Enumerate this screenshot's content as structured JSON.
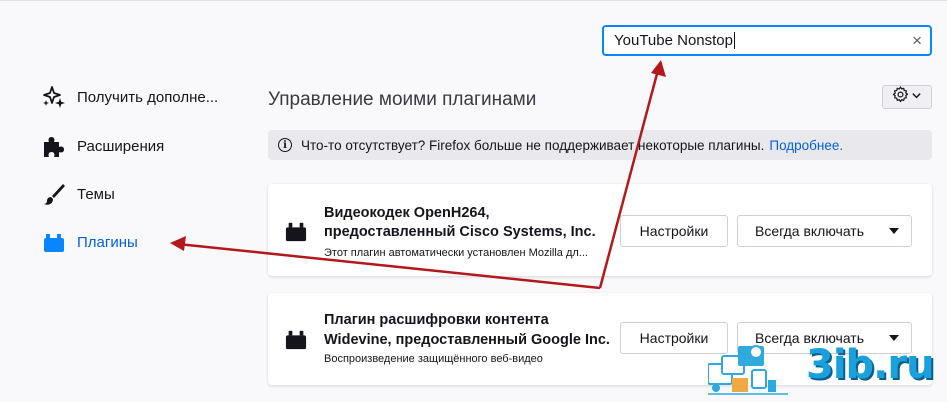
{
  "search": {
    "value": "YouTube Nonstop",
    "clear_icon": "×"
  },
  "sidebar": {
    "items": [
      {
        "label": "Получить дополне...",
        "icon": "sparkle-icon",
        "selected": false
      },
      {
        "label": "Расширения",
        "icon": "puzzle-icon",
        "selected": false
      },
      {
        "label": "Темы",
        "icon": "brush-icon",
        "selected": false
      },
      {
        "label": "Плагины",
        "icon": "plugin-icon",
        "selected": true
      }
    ]
  },
  "main": {
    "heading": "Управление моими плагинами",
    "gear_icon": "gear-icon",
    "notice": {
      "text": "Что-то отсутствует? Firefox больше не поддерживает некоторые плагины.",
      "link": "Подробнее."
    },
    "plugins": [
      {
        "name_line1": "Видеокодек OpenH264,",
        "name_line2": "предоставленный Cisco Systems, Inc.",
        "description": "Этот плагин автоматически установлен Mozilla дл...",
        "settings_label": "Настройки",
        "state_label": "Всегда включать"
      },
      {
        "name_line1": "Плагин расшифровки контента",
        "name_line2": "Widevine, предоставленный Google Inc.",
        "description": "Воспроизведение защищённого веб-видео",
        "settings_label": "Настройки",
        "state_label": "Всегда включать"
      }
    ]
  },
  "watermark": {
    "text": "3ib.ru"
  },
  "colors": {
    "accent": "#0060df",
    "focus": "#0a84ff",
    "annotation": "#b3191c",
    "watermark": "#1aa0dc"
  }
}
